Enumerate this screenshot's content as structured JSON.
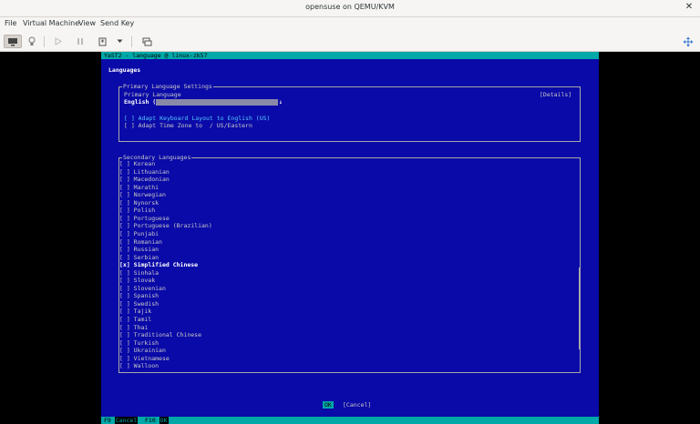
{
  "window": {
    "title": "opensuse on QEMU/KVM"
  },
  "menu": [
    "File",
    "Virtual Machine",
    "View",
    "Send Key"
  ],
  "console": {
    "header": "YaST2 - language @ linux-zk57",
    "heading": "Languages",
    "primary": {
      "frame_label": "Primary Language Settings",
      "label": "Primary Language",
      "details_button": "[Details]",
      "selected_value": "English (US)",
      "combo_arrow": "↓",
      "adapt_keyboard": "[ ] Adapt Keyboard Layout to English (US)",
      "adapt_timezone": "[ ] Adapt Time Zone to  / US/Eastern"
    },
    "secondary": {
      "frame_label": "Secondary Languages",
      "items": [
        "[ ] Korean",
        "[ ] Lithuanian",
        "[ ] Macedonian",
        "[ ] Marathi",
        "[ ] Norwegian",
        "[ ] Nynorsk",
        "[ ] Polish",
        "[ ] Portuguese",
        "[ ] Portuguese (Brazilian)",
        "[ ] Punjabi",
        "[ ] Romanian",
        "[ ] Russian",
        "[ ] Serbian",
        "[x] Simplified Chinese",
        "[ ] Sinhala",
        "[ ] Slovak",
        "[ ] Slovenian",
        "[ ] Spanish",
        "[ ] Swedish",
        "[ ] Tajik",
        "[ ] Tamil",
        "[ ] Thai",
        "[ ] Traditional Chinese",
        "[ ] Turkish",
        "[ ] Ukrainian",
        "[ ] Vietnamese",
        "[ ] Walloon"
      ],
      "checked_index": 13
    },
    "ok_button": "OK",
    "cancel_button": "[Cancel]",
    "fkeys": [
      {
        "key": "F9",
        "label": "Cancel"
      },
      {
        "key": "F10",
        "label": "OK"
      }
    ]
  },
  "icons": {
    "close": "close-icon",
    "monitor": "monitor-icon",
    "lightbulb": "lightbulb-icon",
    "play": "play-icon",
    "pause": "pause-icon",
    "power": "power-icon",
    "dropdown": "chevron-down-icon",
    "screenshot": "screenshot-icon",
    "resize": "resize-icon"
  },
  "colors": {
    "console_bg": "#0a0aa8",
    "accent_bar": "#00a8a8",
    "highlight_text": "#54c8ff"
  }
}
